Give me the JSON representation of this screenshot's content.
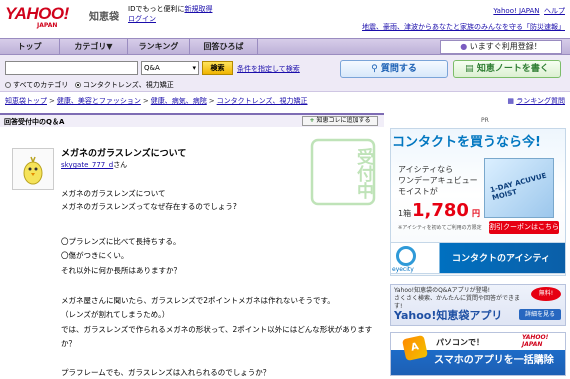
{
  "header": {
    "logo": "YAHOO!",
    "logo_sub": "JAPAN",
    "chiebukuro": "知恵袋",
    "id_text": "IDでもっと便利に",
    "register": "新規取得",
    "login": "ログイン",
    "yahoo_japan": "Yahoo! JAPAN",
    "help": "ヘルプ",
    "notice": "地震、豪雨、津波からあなたと家族のみんなを守る「防災速報」"
  },
  "nav": {
    "items": [
      "トップ",
      "カテゴリ▼",
      "ランキング",
      "回答ひろば"
    ],
    "right": "いますぐ利用登録！"
  },
  "search": {
    "placeholder": "",
    "select": "Q&A",
    "button": "検索",
    "cond_link": "条件を指定して検索",
    "radio_all": "すべてのカテゴリ",
    "radio_this": "コンタクトレンズ、視力矯正",
    "ask": "質問する",
    "note": "知恵ノートを書く"
  },
  "breadcrumb": {
    "items": [
      "知恵袋トップ",
      "健康、美容とファッション",
      "健康、病気、病院",
      "コンタクトレンズ、視力矯正"
    ],
    "sep": ">",
    "ranking": "ランキング質問"
  },
  "section": {
    "title": "回答受付中のQ＆A",
    "add": "知恵コレに追加する"
  },
  "question": {
    "title": "メガネのガラスレンズについて",
    "user": "skygate_777_d",
    "user_suffix": "さん",
    "stamp": "受付中",
    "lines": [
      "メガネのガラスレンズについて",
      "メガネのガラスレンズってなぜ存在するのでしょう?",
      "",
      "〇プラレンズに比べて長持ちする。",
      "〇傷がつきにくい。",
      "それ以外に何か長所はありますか？",
      "",
      "メガネ屋さんに聞いたら、ガラスレンズで2ポイントメガネは作れないそうです。",
      "（レンズが割れてしまうため。）",
      "では、ガラスレンズで作られるメガネの形状って、2ポイント以外にはどんな形状があります",
      "か？",
      "",
      "プラフレームでも、ガラスレンズは入れられるのでしょうか？"
    ]
  },
  "ads": {
    "pr": "PR",
    "ad1_banner": "コンタクトを買うなら今!",
    "ad1_text_lines": [
      "アイシティなら",
      "ワンデーアキュビュー",
      "モイストが"
    ],
    "ad1_box": "1-DAY ACUVUE MOIST",
    "price_pre": "1箱",
    "price": "1,780",
    "price_unit": "円",
    "coupon": "割引クーポンはこちら",
    "note": "※アイシティを初めてご利用の方限定",
    "eyecity": "eyecity",
    "ad1_foot": "コンタクトのアイシティ",
    "ad2_top_lines": [
      "Yahoo!知恵袋のQ&Aアプリが登場!",
      "さくさく検索、かんたんに質問や回答ができます!"
    ],
    "ad2_badge": "無料!",
    "ad2_title": "Yahoo!知恵袋アプリ",
    "ad2_btn": "詳細を見る",
    "ad3_pc": "パソコンで！",
    "ad3_logo": "YAHOO! JAPAN",
    "ad3_text": "スマホのアプリを一括購除",
    "ad3_icon": "A"
  }
}
